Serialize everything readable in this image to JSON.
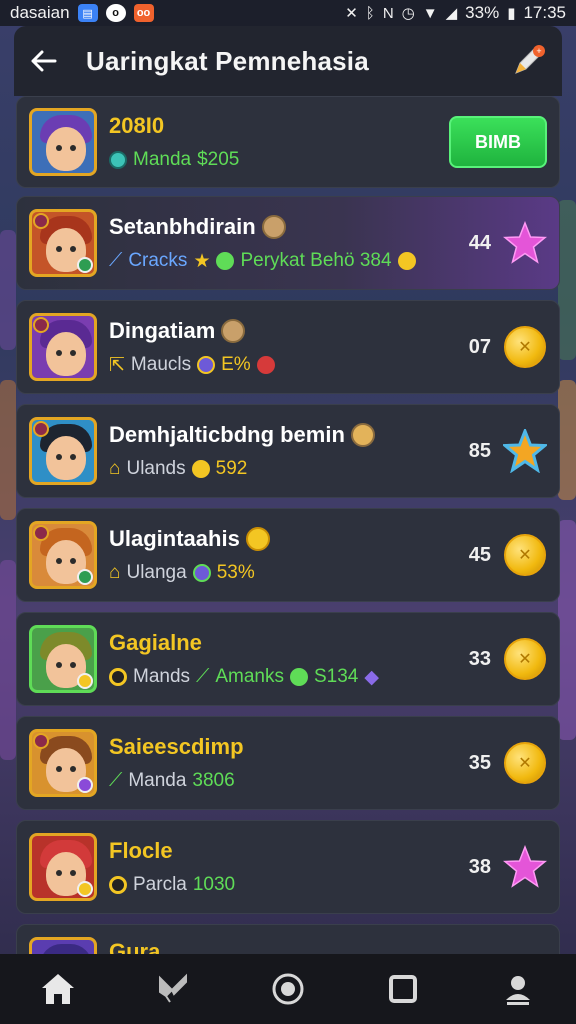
{
  "status_bar": {
    "carrier": "dasaian",
    "battery": "33%",
    "time": "17:35"
  },
  "header": {
    "title": "Uaringkat Pemnehasia"
  },
  "rows": [
    {
      "name": "208I0",
      "sub_label": "Manda",
      "sub_value": "$205",
      "action_label": "BIMB"
    },
    {
      "name": "Setanbhdirain",
      "sub_a": "Cracks",
      "sub_b": "Perykat Behö 384",
      "score": "44"
    },
    {
      "name": "Dingatiam",
      "sub_a": "Maucls",
      "sub_b": "E%",
      "score": "07"
    },
    {
      "name": "Demhjalticbdng bemin",
      "sub_a": "Ulands",
      "sub_b": "592",
      "score": "85"
    },
    {
      "name": "Ulagintaahis",
      "sub_a": "Ulanga",
      "sub_b": "53%",
      "score": "45"
    },
    {
      "name": "Gagialne",
      "sub_a": "Mands",
      "sub_b": "Amanks",
      "sub_c": "S134",
      "score": "33"
    },
    {
      "name": "Saieescdimp",
      "sub_a": "Manda",
      "sub_b": "3806",
      "score": "35"
    },
    {
      "name": "Flocle",
      "sub_a": "Parcla",
      "sub_b": "1030",
      "score": "38"
    },
    {
      "name": "Gura"
    }
  ],
  "colors": {
    "accent_green": "#5fdc57",
    "gold": "#f3c623",
    "card_bg": "#2d313d"
  }
}
